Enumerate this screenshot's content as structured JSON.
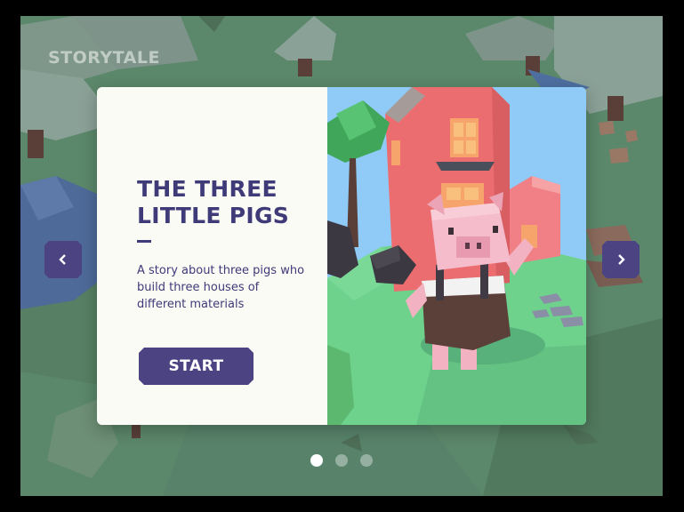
{
  "brand": {
    "name": "STORYTALE"
  },
  "story": {
    "title_line1": "THE THREE",
    "title_line2": "LITTLE PIGS",
    "description": "A story about three pigs who build three houses of different materials",
    "start_label": "START"
  },
  "navigation": {
    "prev_icon": "chevron-left-icon",
    "next_icon": "chevron-right-icon"
  },
  "pagination": {
    "total": 3,
    "active_index": 0
  },
  "colors": {
    "accent": "#4b4382",
    "title_text": "#3f3a78",
    "card_bg": "#fbfbf6",
    "overlay_bg": "#5d8a6a"
  }
}
